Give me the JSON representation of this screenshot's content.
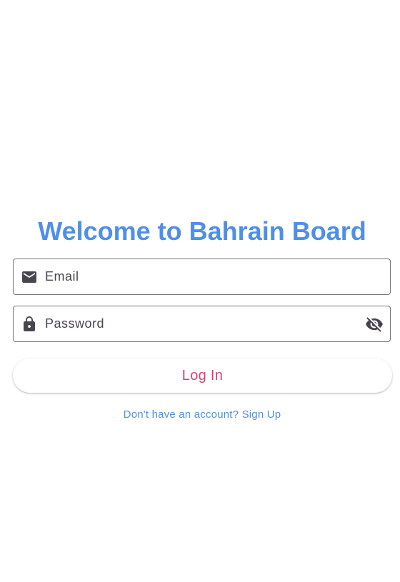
{
  "login": {
    "title": "Welcome to Bahrain Board",
    "email": {
      "value": "",
      "placeholder": "Email",
      "icon": "mail-icon"
    },
    "password": {
      "value": "",
      "placeholder": "Password",
      "icon": "lock-icon",
      "toggle_icon": "visibility-off-icon"
    },
    "login_button_label": "Log In",
    "signup_link": "Don't have an account? Sign Up"
  },
  "colors": {
    "title": "#4f8fe6",
    "button_text": "#d6417a",
    "link": "#4f8fe6",
    "border": "#77767d",
    "icon": "#49454f"
  }
}
